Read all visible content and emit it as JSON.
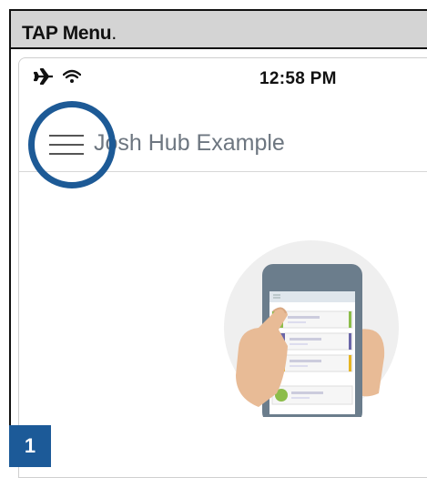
{
  "caption": {
    "bold": "TAP Menu",
    "rest": "."
  },
  "status_bar": {
    "time": "12:58 PM",
    "icons": [
      "airplane-icon",
      "wifi-icon"
    ]
  },
  "nav": {
    "title": "Josh Hub Example",
    "menu_icon": "hamburger-menu-icon"
  },
  "step": {
    "number": "1"
  },
  "colors": {
    "accent": "#1d5a96",
    "caption_bar": "#d4d4d4",
    "title_text": "#6d7680"
  }
}
